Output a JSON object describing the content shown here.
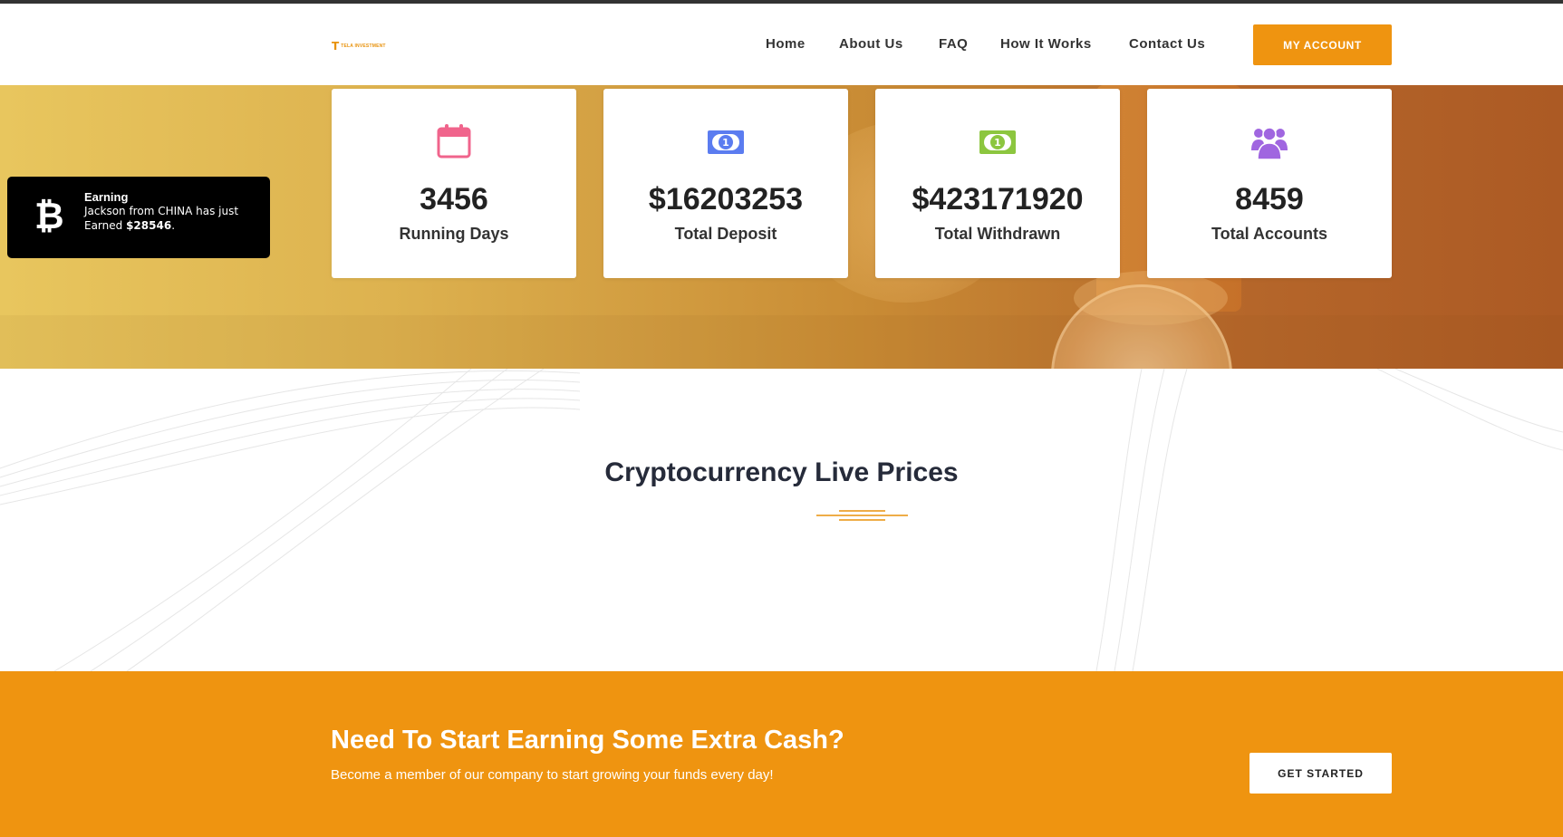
{
  "header": {
    "logo_mark": "T",
    "logo_text": "TELA INVESTMENT",
    "nav": [
      {
        "label": "Home"
      },
      {
        "label": "About Us"
      },
      {
        "label": "FAQ"
      },
      {
        "label": "How It Works"
      },
      {
        "label": "Contact Us"
      }
    ],
    "account_button": "MY ACCOUNT"
  },
  "stats": [
    {
      "value": "3456",
      "label": "Running Days",
      "icon": "calendar-icon",
      "color": "#f0648c"
    },
    {
      "value": "$16203253",
      "label": "Total Deposit",
      "icon": "money-bill-icon",
      "color": "#5b7cf0"
    },
    {
      "value": "$423171920",
      "label": "Total Withdrawn",
      "icon": "money-bill-icon",
      "color": "#8cc63f"
    },
    {
      "value": "8459",
      "label": "Total Accounts",
      "icon": "users-icon",
      "color": "#a066e0"
    }
  ],
  "toast": {
    "icon": "bitcoin-icon",
    "glyph": "₿",
    "title": "Earning",
    "message_prefix": "Jackson from CHINA has just Earned ",
    "amount": "$28546",
    "message_suffix": "."
  },
  "prices_section": {
    "title": "Cryptocurrency Live Prices"
  },
  "cta": {
    "title": "Need To Start Earning Some Extra Cash?",
    "subtitle": "Become a member of our company to start growing your funds every day!",
    "button": "GET STARTED"
  },
  "colors": {
    "accent": "#ef9410",
    "dark_text": "#262b3a"
  }
}
